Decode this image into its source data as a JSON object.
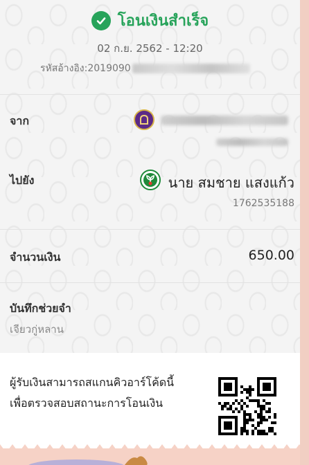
{
  "header": {
    "status_text": "โอนเงินสำเร็จ",
    "datetime": "02 ก.ย. 2562 - 12:20",
    "ref_label": "รหัสอ้างอิง: ",
    "ref_value": "2019090"
  },
  "from": {
    "label": "จาก",
    "icon": "bank-logo-icon"
  },
  "to": {
    "label": "ไปยัง",
    "name": "นาย สมชาย แสงแก้ว",
    "account": "1762535188",
    "icon": "kbank-logo-icon"
  },
  "amount": {
    "label": "จำนวนเงิน",
    "value": "650.00"
  },
  "memo": {
    "label": "บันทึกช่วยจำ",
    "value": "เจียวกู่หลาน"
  },
  "qr_note": {
    "line1": "ผู้รับเงินสามารถสแกนคิวอาร์โค้ดนี้",
    "line2": "เพื่อตรวจสอบสถานะการโอนเงิน"
  },
  "colors": {
    "success": "#27a35a",
    "from_bank": "#5b2a86",
    "to_bank": "#1f8a3a",
    "footer_bg": "#f6d2c6"
  }
}
